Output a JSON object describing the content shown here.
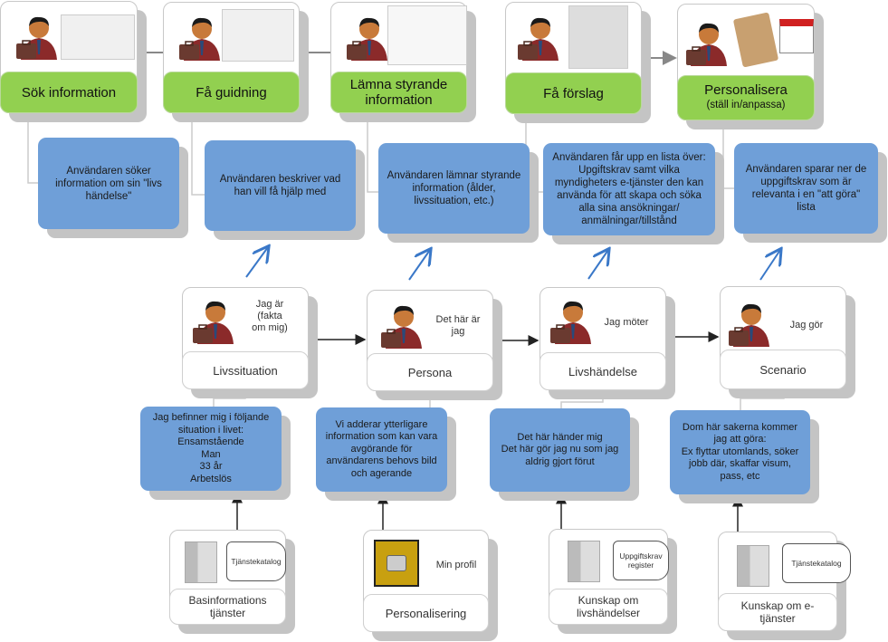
{
  "top_steps": [
    {
      "label": "Sök information",
      "sublabel": "",
      "description": "Användaren söker\ninformation om sin \"livs\nhändelse\""
    },
    {
      "label": "Få guidning",
      "sublabel": "",
      "description": "Användaren beskriver vad\nhan vill få hjälp med"
    },
    {
      "label": "Lämna styrande\ninformation",
      "sublabel": "",
      "description": "Användaren lämnar styrande\ninformation (ålder,\nlivssituation, etc.)"
    },
    {
      "label": "Få förslag",
      "sublabel": "",
      "description": "Användaren får upp en lista över:\nUpgiftskrav samt vilka\nmyndigheters e-tjänster den kan\nanvända för att skapa och söka\nalla sina ansökningar/\nanmälningar/tillstånd"
    },
    {
      "label": "Personalisera",
      "sublabel": "(ställ in/anpassa)",
      "description": "Användaren sparar ner de\nuppgiftskrav som är\nrelevanta i en \"att göra\"\nlista"
    }
  ],
  "middle_steps": [
    {
      "label": "Livssituation",
      "caption": "Jag är\n(fakta\nom mig)",
      "description": "Jag befinner mig i följande\nsituation i livet:\nEnsamstående\nMan\n33 år\nArbetslös"
    },
    {
      "label": "Persona",
      "caption": "Det här är\njag",
      "description": "Vi adderar ytterligare\ninformation som kan vara\navgörande för\nanvändarens behovs bild\noch agerande"
    },
    {
      "label": "Livshändelse",
      "caption": "Jag möter",
      "description": "Det här händer mig\nDet här gör jag nu som jag\naldrig gjort förut"
    },
    {
      "label": "Scenario",
      "caption": "Jag gör",
      "description": "Dom här sakerna kommer\njag att göra:\nEx flyttar utomlands, söker\njobb där, skaffar visum,\npass, etc"
    }
  ],
  "sources": [
    {
      "label": "Basinformations\ntjänster",
      "store": "Tjänstekatalog"
    },
    {
      "label": "Personalisering",
      "store": "Min profil"
    },
    {
      "label": "Kunskap om\nlivshändelser",
      "store": "Uppgiftskrav\nregister"
    },
    {
      "label": "Kunskap om e-\ntjänster",
      "store": "Tjänstekatalog"
    }
  ],
  "colors": {
    "green": "#92d050",
    "blue": "#6f9fd8",
    "arrow_blue": "#3a78c8"
  }
}
